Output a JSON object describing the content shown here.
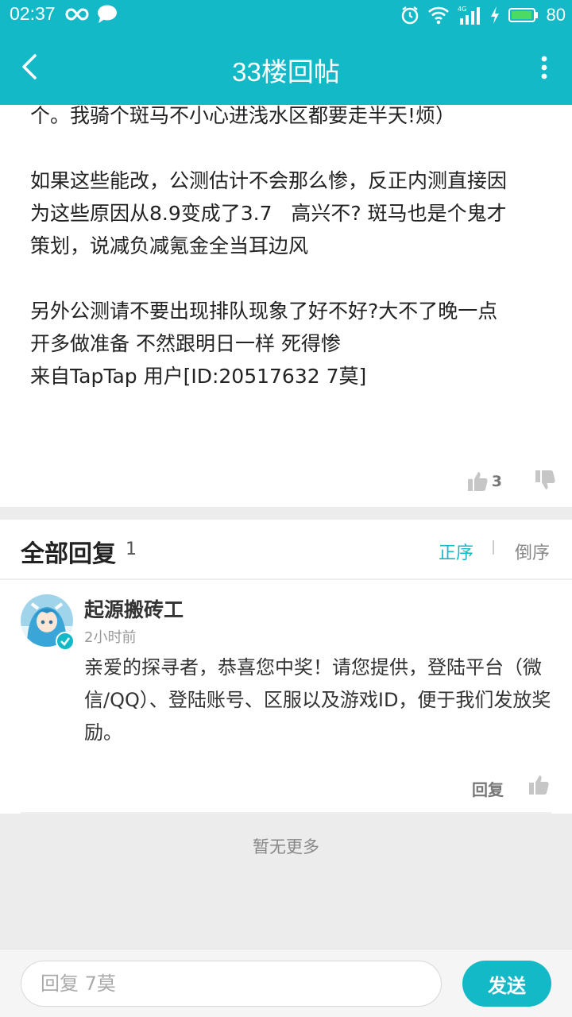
{
  "status_bar": {
    "time": "02:37",
    "battery_level": "80",
    "network": "4G",
    "icons": [
      "infinity-icon",
      "chat-bubble-icon",
      "alarm-icon",
      "wifi-icon",
      "signal-icon",
      "charging-icon",
      "battery-icon"
    ]
  },
  "header": {
    "title": "33楼回帖",
    "back_icon": "chevron-left-icon",
    "menu_icon": "more-vertical-icon",
    "color": "#14b9c8"
  },
  "post": {
    "lines": [
      "个。我骑个斑马不小心进浅水区都要走半天!烦）",
      "",
      "如果这些能改，公测估计不会那么惨，反正内测直接因",
      "为这些原因从8.9变成了3.7   高兴不? 斑马也是个鬼才",
      "策划，说减负减氪金全当耳边风",
      "",
      "另外公测请不要出现排队现象了好不好?大不了晚一点",
      "开多做准备 不然跟明日一样 死得惨",
      "来自TapTap 用户[ID:20517632 7莫]"
    ],
    "like_count": "3"
  },
  "replies": {
    "title": "全部回复",
    "count": "1",
    "sort_asc": "正序",
    "sort_desc": "倒序",
    "items": [
      {
        "author": "起源搬砖工",
        "time": "2小时前",
        "text": "亲爱的探寻者，恭喜您中奖！请您提供，登陆平台（微信/QQ）、登陆账号、区服以及游戏ID，便于我们发放奖励。",
        "reply_label": "回复"
      }
    ]
  },
  "no_more": "暂无更多",
  "composer": {
    "placeholder": "回复 7莫",
    "send_label": "发送"
  }
}
